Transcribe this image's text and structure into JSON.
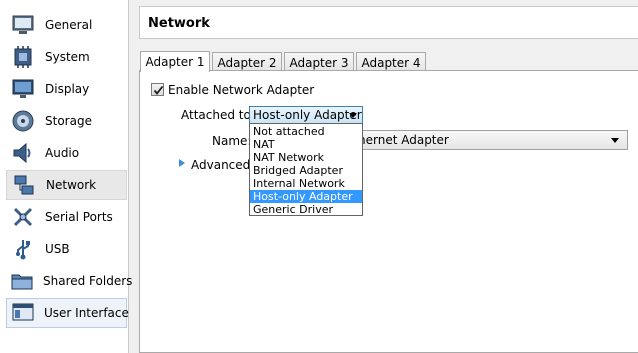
{
  "sidebar": {
    "items": [
      {
        "label": "General",
        "icon": "general-icon"
      },
      {
        "label": "System",
        "icon": "system-icon"
      },
      {
        "label": "Display",
        "icon": "display-icon"
      },
      {
        "label": "Storage",
        "icon": "storage-icon"
      },
      {
        "label": "Audio",
        "icon": "audio-icon"
      },
      {
        "label": "Network",
        "icon": "network-icon"
      },
      {
        "label": "Serial Ports",
        "icon": "serial-ports-icon"
      },
      {
        "label": "USB",
        "icon": "usb-icon"
      },
      {
        "label": "Shared Folders",
        "icon": "shared-folders-icon"
      },
      {
        "label": "User Interface",
        "icon": "user-interface-icon"
      }
    ],
    "selected": "Network"
  },
  "header": {
    "title": "Network"
  },
  "tabs": [
    {
      "label": "Adapter 1"
    },
    {
      "label": "Adapter 2"
    },
    {
      "label": "Adapter 3"
    },
    {
      "label": "Adapter 4"
    }
  ],
  "adapter": {
    "enable_label": "Enable Network Adapter",
    "enabled": true,
    "attached_label": "Attached to:",
    "attached_value": "Host-only Adapter",
    "name_label": "Name:",
    "name_value": "hernet Adapter",
    "advanced_label": "Advanced"
  },
  "dropdown": {
    "options": [
      "Not attached",
      "NAT",
      "NAT Network",
      "Bridged Adapter",
      "Internal Network",
      "Host-only Adapter",
      "Generic Driver"
    ],
    "selected": "Host-only Adapter"
  },
  "colors": {
    "selection": "#3399ff",
    "combo_focus_border": "#3c7fb1",
    "advanced_arrow": "#3b8fd8"
  }
}
